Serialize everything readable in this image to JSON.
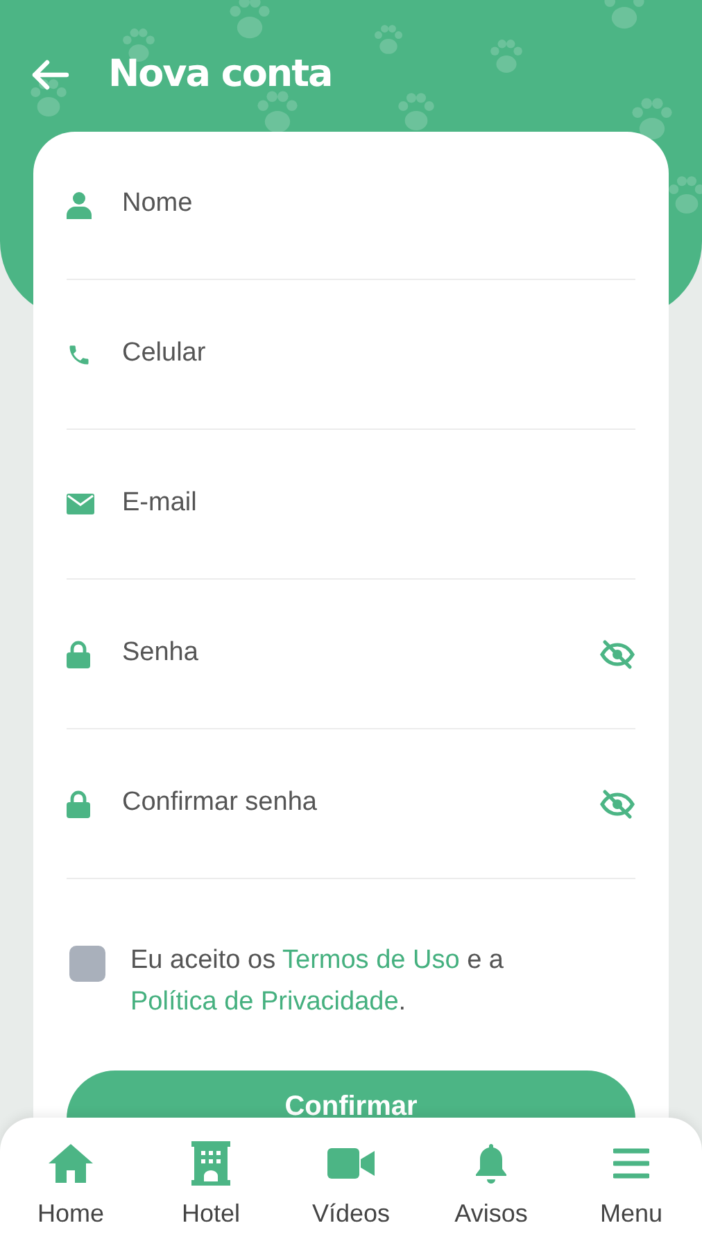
{
  "header": {
    "title": "Nova conta"
  },
  "fields": [
    {
      "kind": "person",
      "placeholder": "Nome"
    },
    {
      "kind": "phone",
      "placeholder": "Celular"
    },
    {
      "kind": "email",
      "placeholder": "E-mail"
    },
    {
      "kind": "password",
      "placeholder": "Senha"
    },
    {
      "kind": "password",
      "placeholder": "Confirmar senha"
    }
  ],
  "terms": {
    "checked": false,
    "parts": [
      {
        "kind": "text",
        "text": "Eu aceito os"
      },
      {
        "kind": "link",
        "text": "Termos de Uso"
      },
      {
        "kind": "text",
        "text": "e a"
      },
      {
        "kind": "link",
        "text": "Política de Privacidade"
      },
      {
        "kind": "text",
        "text": "."
      }
    ]
  },
  "button": {
    "label": "Confirmar"
  },
  "nav": [
    {
      "kind": "home",
      "label": "Home"
    },
    {
      "kind": "hotel",
      "label": "Hotel"
    },
    {
      "kind": "video",
      "label": "Vídeos"
    },
    {
      "kind": "bell",
      "label": "Avisos"
    },
    {
      "kind": "menu",
      "label": "Menu"
    }
  ]
}
